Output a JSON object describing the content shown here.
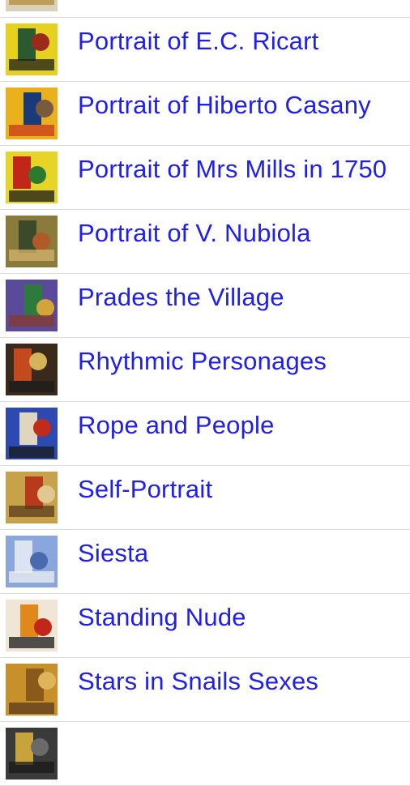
{
  "colors": {
    "link": "#1e1ef0",
    "divider": "#dcdcdc",
    "background": "#ffffff"
  },
  "items": [
    {
      "title": "",
      "thumb_palette": [
        "#d9d2b8",
        "#6b4a2a",
        "#3d6b3a",
        "#b58a3a"
      ]
    },
    {
      "title": "Portrait of E.C. Ricart",
      "thumb_palette": [
        "#e6d21e",
        "#2b5a2e",
        "#9b2a1c",
        "#1c1c1c"
      ]
    },
    {
      "title": "Portrait of Hiberto Casany",
      "thumb_palette": [
        "#e9b21c",
        "#1a3b7a",
        "#7a5a3c",
        "#c7381e"
      ]
    },
    {
      "title": "Portrait of Mrs Mills in 1750",
      "thumb_palette": [
        "#e6d426",
        "#c2261a",
        "#2c7a2e",
        "#1a1a1a"
      ]
    },
    {
      "title": "Portrait of V. Nubiola",
      "thumb_palette": [
        "#8a7a3c",
        "#3a4a2a",
        "#b05a2a",
        "#d4b46a"
      ]
    },
    {
      "title": "Prades the Village",
      "thumb_palette": [
        "#5a4a9a",
        "#2e7a3c",
        "#d4a43a",
        "#8a3a2a"
      ]
    },
    {
      "title": "Rhythmic Personages",
      "thumb_palette": [
        "#3a2a1c",
        "#c24a1c",
        "#d4b45a",
        "#1c1c1c"
      ]
    },
    {
      "title": "Rope and People",
      "thumb_palette": [
        "#2c4ab0",
        "#e0d6c0",
        "#c22a1c",
        "#1a1a1a"
      ]
    },
    {
      "title": "Self-Portrait",
      "thumb_palette": [
        "#c8a24a",
        "#b83a1c",
        "#e0c890",
        "#5a3a1c"
      ]
    },
    {
      "title": "Siesta",
      "thumb_palette": [
        "#8aa6dc",
        "#dbe4f0",
        "#4a6ab0",
        "#f0f0f0"
      ]
    },
    {
      "title": "Standing Nude",
      "thumb_palette": [
        "#f0e6d6",
        "#e0881c",
        "#c2261a",
        "#1a1a1a"
      ]
    },
    {
      "title": "Stars in Snails Sexes",
      "thumb_palette": [
        "#c8902a",
        "#8a5a1c",
        "#e0b45a",
        "#5a3a1c"
      ]
    },
    {
      "title": "",
      "thumb_palette": [
        "#3a3a3a",
        "#c8a23a",
        "#6a6a6a",
        "#1a1a1a"
      ]
    }
  ]
}
